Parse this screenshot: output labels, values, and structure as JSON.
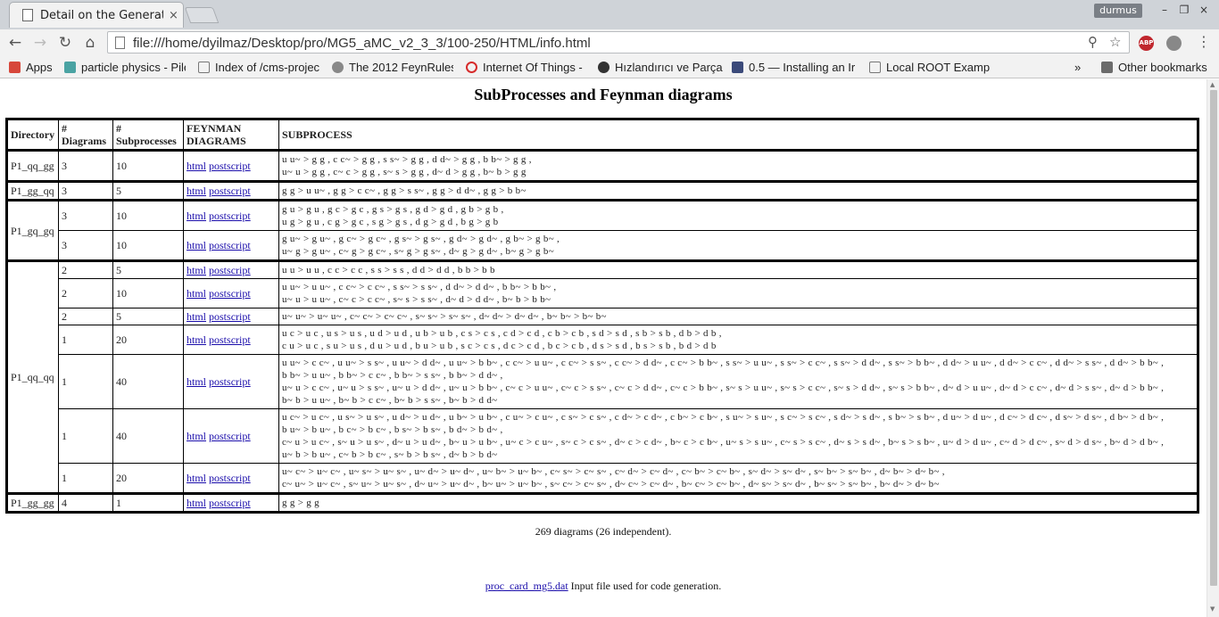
{
  "browser": {
    "tab_title": "Detail on the Generation",
    "tab_close": "×",
    "user_badge": "durmus",
    "win_min": "–",
    "win_max": "❐",
    "win_close": "×",
    "url": "file:///home/dyilmaz/Desktop/pro/MG5_aMC_v2_3_3/100-250/HTML/info.html",
    "ext_abp": "ABP"
  },
  "bookmarks": {
    "items": [
      {
        "label": "Apps",
        "color": "#d7473b"
      },
      {
        "label": "particle physics - Pile",
        "color": "#4aa3a3"
      },
      {
        "label": "Index of /cms-projec",
        "color": "#ffffff"
      },
      {
        "label": "The 2012 FeynRules/",
        "color": "#888888"
      },
      {
        "label": "Internet Of Things - ",
        "color": "#d62b2b"
      },
      {
        "label": "Hızlandırıcı ve Parça",
        "color": "#333333"
      },
      {
        "label": "0.5 — Installing an Ir",
        "color": "#3b4a7a"
      },
      {
        "label": "Local ROOT Example",
        "color": "#ffffff"
      }
    ],
    "overflow": "»",
    "other": "Other bookmarks"
  },
  "page": {
    "title": "SubProcesses and Feynman diagrams",
    "headers": {
      "directory": "Directory",
      "diagrams": "# Diagrams",
      "subprocesses": "# Subprocesses",
      "feynman": "FEYNMAN DIAGRAMS",
      "subprocess": "SUBPROCESS"
    },
    "link_html": "html",
    "link_ps": "postscript",
    "groups": [
      {
        "directory": "P1_qq_gg",
        "rows": [
          {
            "diagrams": "3",
            "subprocesses": "10",
            "process": "u u~ > g g , c c~ > g g , s s~ > g g , d d~ > g g , b b~ > g g ,\nu~ u > g g , c~ c > g g , s~ s > g g , d~ d > g g , b~ b > g g"
          }
        ]
      },
      {
        "directory": "P1_gg_qq",
        "rows": [
          {
            "diagrams": "3",
            "subprocesses": "5",
            "process": "g g > u u~ , g g > c c~ , g g > s s~ , g g > d d~ , g g > b b~"
          }
        ]
      },
      {
        "directory": "P1_gq_gq",
        "rows": [
          {
            "diagrams": "3",
            "subprocesses": "10",
            "process": "g u > g u , g c > g c , g s > g s , g d > g d , g b > g b ,\nu g > g u , c g > g c , s g > g s , d g > g d , b g > g b"
          },
          {
            "diagrams": "3",
            "subprocesses": "10",
            "process": "g u~ > g u~ , g c~ > g c~ , g s~ > g s~ , g d~ > g d~ , g b~ > g b~ ,\nu~ g > g u~ , c~ g > g c~ , s~ g > g s~ , d~ g > g d~ , b~ g > g b~"
          }
        ]
      },
      {
        "directory": "P1_qq_qq",
        "rows": [
          {
            "diagrams": "2",
            "subprocesses": "5",
            "process": "u u > u u , c c > c c , s s > s s , d d > d d , b b > b b"
          },
          {
            "diagrams": "2",
            "subprocesses": "10",
            "process": "u u~ > u u~ , c c~ > c c~ , s s~ > s s~ , d d~ > d d~ , b b~ > b b~ ,\nu~ u > u u~ , c~ c > c c~ , s~ s > s s~ , d~ d > d d~ , b~ b > b b~"
          },
          {
            "diagrams": "2",
            "subprocesses": "5",
            "process": "u~ u~ > u~ u~ , c~ c~ > c~ c~ , s~ s~ > s~ s~ , d~ d~ > d~ d~ , b~ b~ > b~ b~"
          },
          {
            "diagrams": "1",
            "subprocesses": "20",
            "process": "u c > u c , u s > u s , u d > u d , u b > u b , c s > c s , c d > c d , c b > c b , s d > s d , s b > s b , d b > d b ,\nc u > u c , s u > u s , d u > u d , b u > u b , s c > c s , d c > c d , b c > c b , d s > s d , b s > s b , b d > d b"
          },
          {
            "diagrams": "1",
            "subprocesses": "40",
            "process": "u u~ > c c~ , u u~ > s s~ , u u~ > d d~ , u u~ > b b~ , c c~ > u u~ , c c~ > s s~ , c c~ > d d~ , c c~ > b b~ , s s~ > u u~ , s s~ > c c~ , s s~ > d d~ , s s~ > b b~ , d d~ > u u~ , d d~ > c c~ , d d~ > s s~ , d d~ > b b~ ,\nb b~ > u u~ , b b~ > c c~ , b b~ > s s~ , b b~ > d d~ ,\nu~ u > c c~ , u~ u > s s~ , u~ u > d d~ , u~ u > b b~ , c~ c > u u~ , c~ c > s s~ , c~ c > d d~ , c~ c > b b~ , s~ s > u u~ , s~ s > c c~ , s~ s > d d~ , s~ s > b b~ , d~ d > u u~ , d~ d > c c~ , d~ d > s s~ , d~ d > b b~ ,\nb~ b > u u~ , b~ b > c c~ , b~ b > s s~ , b~ b > d d~"
          },
          {
            "diagrams": "1",
            "subprocesses": "40",
            "process": "u c~ > u c~ , u s~ > u s~ , u d~ > u d~ , u b~ > u b~ , c u~ > c u~ , c s~ > c s~ , c d~ > c d~ , c b~ > c b~ , s u~ > s u~ , s c~ > s c~ , s d~ > s d~ , s b~ > s b~ , d u~ > d u~ , d c~ > d c~ , d s~ > d s~ , d b~ > d b~ ,\nb u~ > b u~ , b c~ > b c~ , b s~ > b s~ , b d~ > b d~ ,\nc~ u > u c~ , s~ u > u s~ , d~ u > u d~ , b~ u > u b~ , u~ c > c u~ , s~ c > c s~ , d~ c > c d~ , b~ c > c b~ , u~ s > s u~ , c~ s > s c~ , d~ s > s d~ , b~ s > s b~ , u~ d > d u~ , c~ d > d c~ , s~ d > d s~ , b~ d > d b~ ,\nu~ b > b u~ , c~ b > b c~ , s~ b > b s~ , d~ b > b d~"
          },
          {
            "diagrams": "1",
            "subprocesses": "20",
            "process": "u~ c~ > u~ c~ , u~ s~ > u~ s~ , u~ d~ > u~ d~ , u~ b~ > u~ b~ , c~ s~ > c~ s~ , c~ d~ > c~ d~ , c~ b~ > c~ b~ , s~ d~ > s~ d~ , s~ b~ > s~ b~ , d~ b~ > d~ b~ ,\nc~ u~ > u~ c~ , s~ u~ > u~ s~ , d~ u~ > u~ d~ , b~ u~ > u~ b~ , s~ c~ > c~ s~ , d~ c~ > c~ d~ , b~ c~ > c~ b~ , d~ s~ > s~ d~ , b~ s~ > s~ b~ , b~ d~ > d~ b~"
          }
        ]
      },
      {
        "directory": "P1_gg_gg",
        "rows": [
          {
            "diagrams": "4",
            "subprocesses": "1",
            "process": "g g > g g"
          }
        ]
      }
    ],
    "summary": "269 diagrams (26 independent).",
    "footer_link": "proc_card_mg5.dat",
    "footer_text": " Input file used for code generation."
  }
}
